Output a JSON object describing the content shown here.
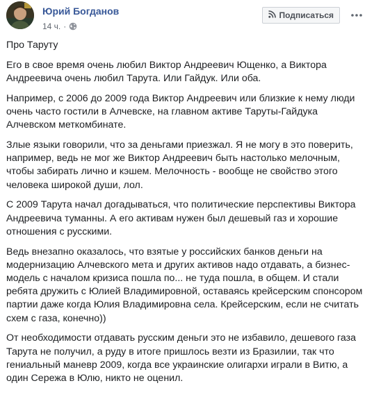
{
  "post": {
    "author": "Юрий Богданов",
    "time": "14 ч.",
    "dot": "·",
    "subscribe_label": "Подписаться",
    "icons": {
      "avatar": "avatar",
      "globe": "globe-icon",
      "rss": "rss-icon",
      "more": "more-options-icon"
    },
    "paragraphs": [
      "Про Таруту",
      "Его в свое время очень любил Виктор Андреевич Ющенко, а Виктора Андреевича очень любил Тарута. Или Гайдук. Или оба.",
      "Например, с 2006 до 2009 года Виктор Андреевич или близкие к нему люди очень часто гостили в Алчевске, на главном активе Таруты-Гайдука Алчевском меткомбинате.",
      "Злые языки говорили, что за деньгами приезжал. Я не могу в это поверить, например, ведь не мог же Виктор Андреевич быть настолько мелочным, чтобы забирать лично и кэшем. Мелочность - вообще не свойство этого человека широкой души, лол.",
      "С 2009 Тарута начал догадываться, что политические перспективы Виктора Андреевича туманны. А его активам нужен был дешевый газ и хорошие отношения с русскими.",
      "Ведь внезапно оказалось, что взятые у российских банков деньги на модернизацию Алчевского мета и других активов надо отдавать, а бизнес-модель с началом кризиса пошла по... не туда пошла, в общем. И стали ребята дружить с Юлией Владимировной, оставаясь крейсерским спонсором партии даже когда Юлия Владимировна села. Крейсерским, если не считать схем с газа, конечно))",
      "От необходимости отдавать русским деньги это не избавило, дешевого газа Тарута не получил, а руду в итоге пришлось везти из Бразилии, так что гениальный маневр 2009, когда все украинские олигархи играли в Витю, а один Сережа в Юлю, никто не оценил."
    ]
  }
}
